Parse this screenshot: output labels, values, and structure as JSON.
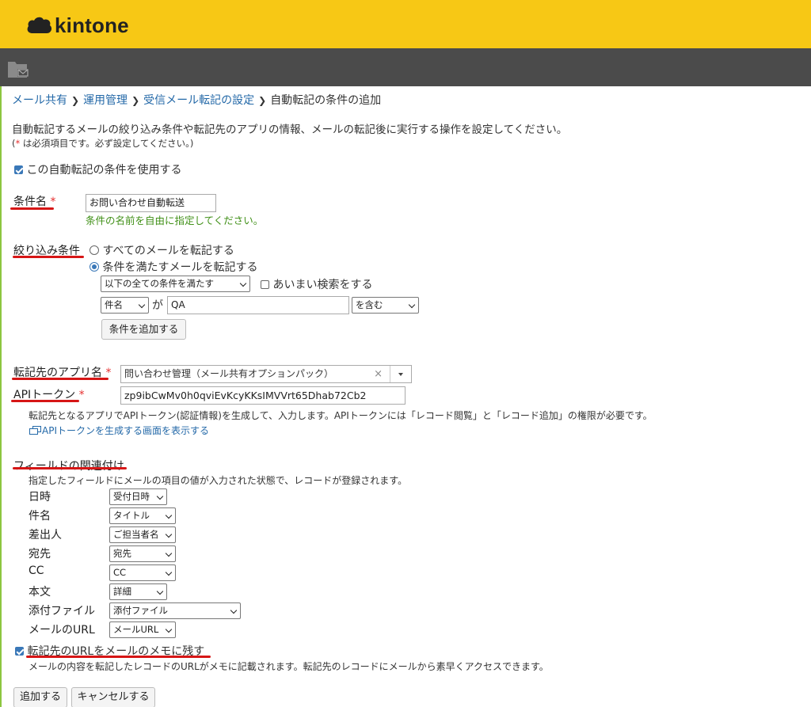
{
  "brand": {
    "name": "kintone"
  },
  "breadcrumb": [
    {
      "label": "メール共有"
    },
    {
      "label": "運用管理"
    },
    {
      "label": "受信メール転記の設定"
    },
    {
      "label": "自動転記の条件の追加"
    }
  ],
  "intro": {
    "description": "自動転記するメールの絞り込み条件や転記先のアプリの情報、メールの転記後に実行する操作を設定してください。",
    "required_note_asterisk": "*",
    "required_note_text": " は必須項目です。必ず設定してください。)",
    "required_note_open": "("
  },
  "enable_checkbox": {
    "label": "この自動転記の条件を使用する",
    "checked": true
  },
  "condition_name": {
    "label": "条件名",
    "required_mark": "*",
    "value": "お問い合わせ自動転送",
    "hint": "条件の名前を自由に指定してください。"
  },
  "filter": {
    "label": "絞り込み条件",
    "option_all": "すべてのメールを転記する",
    "option_match": "条件を満たすメールを転記する",
    "selected": "option_match",
    "mode_select": "以下の全ての条件を満たす",
    "fuzzy_checkbox": "あいまい検索をする",
    "rule": {
      "field": "件名",
      "particle": "が",
      "value": "QA",
      "operator": "を含む"
    },
    "add_button": "条件を追加する"
  },
  "target_app": {
    "label": "転記先のアプリ名",
    "required_mark": "*",
    "value": "問い合わせ管理（メール共有オプションパック）",
    "clear_icon": "×"
  },
  "api_token": {
    "label": "APIトークン",
    "required_mark": "*",
    "value": "zp9ibCwMv0h0qviEvKcyKKsIMVVrt65Dhab72Cb2",
    "hint": "転記先となるアプリでAPIトークン(認証情報)を生成して、入力します。APIトークンには「レコード閲覧」と「レコード追加」の権限が必要です。",
    "link": "APIトークンを生成する画面を表示する"
  },
  "field_mapping": {
    "title": "フィールドの関連付け",
    "hint": "指定したフィールドにメールの項目の値が入力された状態で、レコードが登録されます。",
    "rows": [
      {
        "label": "日時",
        "value": "受付日時"
      },
      {
        "label": "件名",
        "value": "タイトル"
      },
      {
        "label": "差出人",
        "value": "ご担当者名"
      },
      {
        "label": "宛先",
        "value": "宛先"
      },
      {
        "label": "CC",
        "value": "CC"
      },
      {
        "label": "本文",
        "value": "詳細"
      },
      {
        "label": "添付ファイル",
        "value": "添付ファイル"
      },
      {
        "label": "メールのURL",
        "value": "メールURL"
      }
    ]
  },
  "memo_checkbox": {
    "label": "転記先のURLをメールのメモに残す",
    "checked": true,
    "hint": "メールの内容を転記したレコードのURLがメモに記載されます。転記先のレコードにメールから素早くアクセスできます。"
  },
  "actions": {
    "add": "追加する",
    "cancel": "キャンセルする"
  },
  "colors": {
    "header": "#f7c815",
    "appbar": "#4b4b4b",
    "link": "#2469a8",
    "required": "#e63030",
    "annotation": "#d61616"
  }
}
